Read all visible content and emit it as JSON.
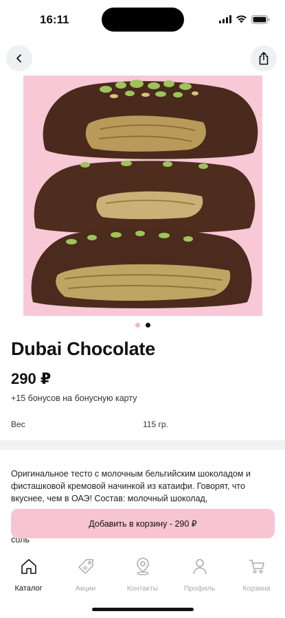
{
  "status_bar": {
    "time": "16:11"
  },
  "product": {
    "title": "Dubai Chocolate",
    "price": "290 ₽",
    "bonus": "+15 бонусов на бонусную карту",
    "weight_label": "Вес",
    "weight_value": "115 гр.",
    "description": "Оригинальное тесто с молочным бельгийским шоколадом и фисташковой кремовой начинкой из катаифи. Говорят, что вкуснее, чем в ОАЭ! Состав: молочный шоколад,",
    "description_tail": "соль"
  },
  "gallery": {
    "image_count": 2,
    "active_index": 1
  },
  "actions": {
    "add_to_cart": "Добавить в корзину - 290 ₽"
  },
  "tabbar": {
    "items": [
      {
        "label": "Каталог",
        "icon": "home-icon",
        "active": true
      },
      {
        "label": "Акции",
        "icon": "tag-icon",
        "active": false
      },
      {
        "label": "Контакты",
        "icon": "location-pin-icon",
        "active": false
      },
      {
        "label": "Профиль",
        "icon": "person-icon",
        "active": false
      },
      {
        "label": "Корзина",
        "icon": "cart-icon",
        "active": false
      }
    ]
  },
  "colors": {
    "accent_pink": "#f7c4d2",
    "image_background": "#f8c8d6",
    "text": "#111111",
    "muted": "#a5a8ae"
  }
}
